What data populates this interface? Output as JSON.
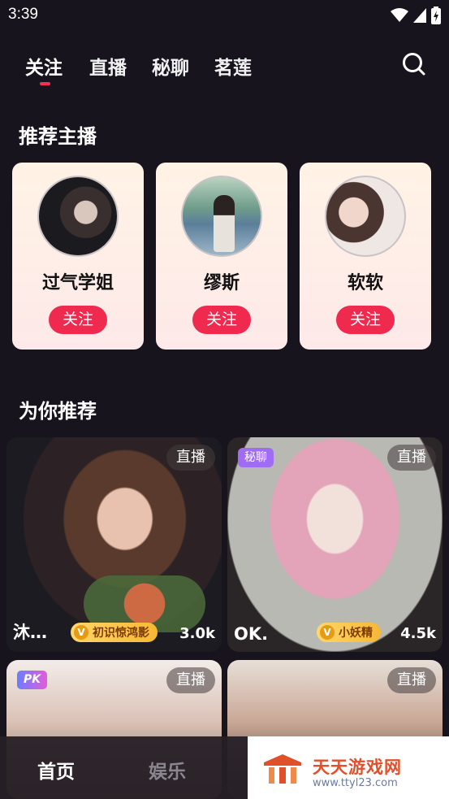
{
  "status_bar": {
    "time": "3:39"
  },
  "top_tabs": [
    {
      "label": "关注",
      "active": true
    },
    {
      "label": "直播",
      "active": false
    },
    {
      "label": "秘聊",
      "active": false
    },
    {
      "label": "茗莲",
      "active": false
    }
  ],
  "recommended_anchors": {
    "title": "推荐主播",
    "items": [
      {
        "name": "过气学姐",
        "follow_label": "关注"
      },
      {
        "name": "缪斯",
        "follow_label": "关注"
      },
      {
        "name": "软软",
        "follow_label": "关注"
      }
    ]
  },
  "for_you": {
    "title": "为你推荐",
    "cards": [
      {
        "badge": "直播",
        "name": "沐…",
        "level_icon": "V",
        "level": "初识惊鸿影",
        "viewers": "3.0k"
      },
      {
        "badge": "直播",
        "secret_badge": "秘聊",
        "name": "OK.",
        "level_icon": "V",
        "level": "小妖精",
        "viewers": "4.5k"
      },
      {
        "badge": "直播",
        "pk_badge": "PK"
      },
      {
        "badge": "直播"
      }
    ]
  },
  "bottom_nav": [
    {
      "label": "首页",
      "active": true
    },
    {
      "label": "娱乐",
      "active": false
    }
  ],
  "watermark": {
    "title": "天天游戏网",
    "url": "www.ttyl23.com"
  },
  "colors": {
    "accent": "#f0294f",
    "background": "#17141d",
    "card": "#fff3e5"
  }
}
